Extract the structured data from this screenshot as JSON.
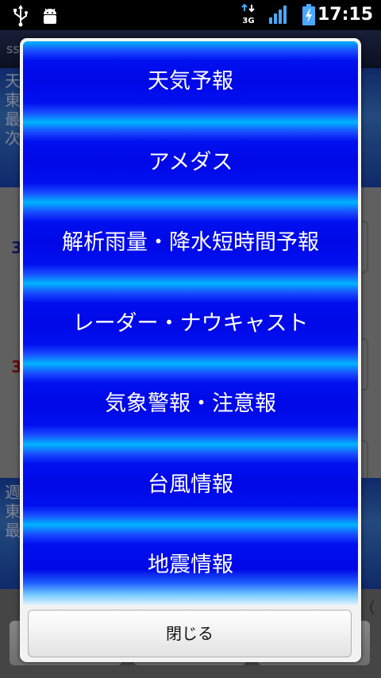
{
  "status_bar": {
    "time": "17:15",
    "network_label": "3G",
    "icons": [
      "usb-icon",
      "debug-bug-icon",
      "network-3g-icon",
      "signal-strength-icon",
      "battery-charging-icon"
    ]
  },
  "background_app": {
    "title": "ss",
    "section1_lines": [
      "天",
      "東",
      "最",
      "次"
    ],
    "number1": "3",
    "number2": "3",
    "section2_lines": [
      "週",
      "東",
      "最"
    ],
    "bottom_text": "（"
  },
  "dialog": {
    "menu_items": [
      {
        "label": "天気予報"
      },
      {
        "label": "アメダス"
      },
      {
        "label": "解析雨量・降水短時間予報"
      },
      {
        "label": "レーダー・ナウキャスト"
      },
      {
        "label": "気象警報・注意報"
      },
      {
        "label": "台風情報"
      },
      {
        "label": "地震情報"
      }
    ],
    "close_label": "閉じる"
  },
  "colors": {
    "menu_blue": "#0008e6",
    "menu_cyan": "#00b4ff",
    "status_bar_bg": "#000000",
    "app_blue": "#1a48b8"
  }
}
